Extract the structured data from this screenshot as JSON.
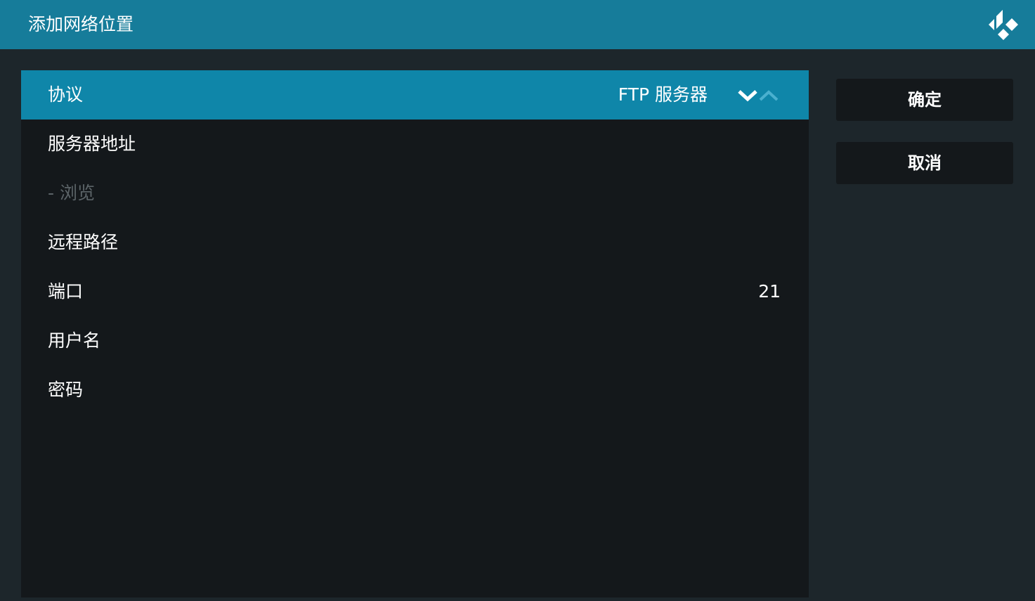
{
  "header": {
    "title": "添加网络位置",
    "logo_icon": "kodi-logo-icon"
  },
  "settings": [
    {
      "label": "协议",
      "value": "FTP 服务器",
      "selected": true,
      "has_spinner": true
    },
    {
      "label": "服务器地址",
      "value": ""
    },
    {
      "label": "- 浏览",
      "value": "",
      "disabled": true
    },
    {
      "label": "远程路径",
      "value": ""
    },
    {
      "label": "端口",
      "value": "21"
    },
    {
      "label": "用户名",
      "value": ""
    },
    {
      "label": "密码",
      "value": ""
    }
  ],
  "buttons": {
    "ok_label": "确定",
    "cancel_label": "取消"
  },
  "colors": {
    "header_bg": "#167c9a",
    "selected_row_bg": "#0f86a9",
    "panel_bg": "#14181b",
    "page_bg": "#1d262b",
    "disabled_text": "#5c6468"
  }
}
